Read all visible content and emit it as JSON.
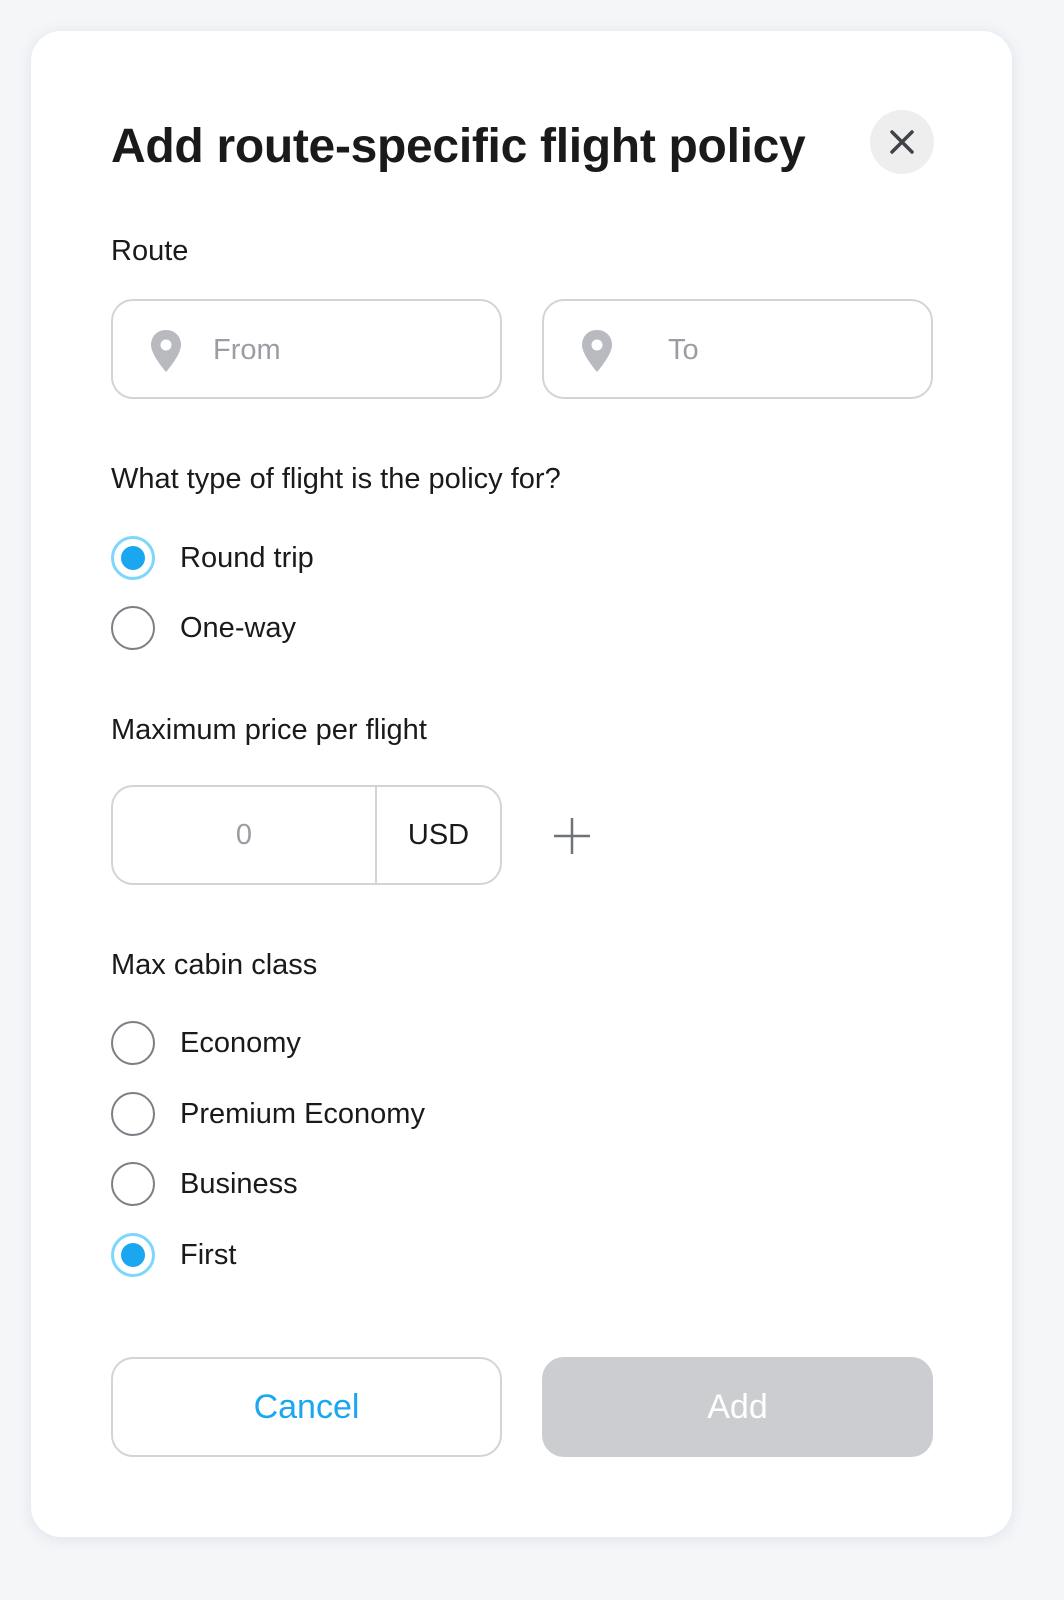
{
  "dialog": {
    "title": "Add route-specific flight policy"
  },
  "route": {
    "label": "Route",
    "from_placeholder": "From",
    "to_placeholder": "To"
  },
  "flight_type": {
    "label": "What type of flight is the policy for?",
    "options": [
      {
        "label": "Round trip",
        "selected": true
      },
      {
        "label": "One-way",
        "selected": false
      }
    ]
  },
  "max_price": {
    "label": "Maximum price per flight",
    "value": "0",
    "currency": "USD"
  },
  "cabin_class": {
    "label": "Max cabin class",
    "options": [
      {
        "label": "Economy",
        "selected": false
      },
      {
        "label": "Premium Economy",
        "selected": false
      },
      {
        "label": "Business",
        "selected": false
      },
      {
        "label": "First",
        "selected": true
      }
    ]
  },
  "actions": {
    "cancel_label": "Cancel",
    "add_label": "Add"
  },
  "colors": {
    "accent": "#1aa7ef",
    "radio_ring": "#7dd6fb",
    "disabled_button": "#cbcdd1",
    "border": "#d2d4d8"
  },
  "icons": {
    "close": "close-icon",
    "location": "location-pin-icon",
    "plus": "plus-icon"
  }
}
